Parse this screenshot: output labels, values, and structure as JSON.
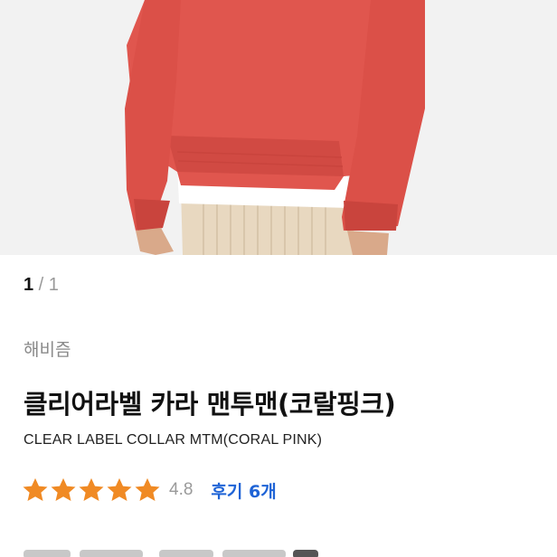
{
  "gallery": {
    "current_page": "1",
    "separator": " / ",
    "total_pages": "1"
  },
  "product": {
    "brand": "해비즘",
    "title": "클리어라벨 카라 맨투맨(코랄핑크)",
    "subtitle": "CLEAR LABEL COLLAR MTM(CORAL PINK)",
    "rating": 4.8,
    "rating_text": "4.8",
    "review_link": "후기 6개",
    "star_icon": "star-icon",
    "star_color": "#f08a24"
  },
  "colors": {
    "sweatshirt": "#e0564e",
    "shirt": "#ffffff",
    "pants": "#e8d8c0",
    "background": "#f2f2f2",
    "link": "#1e63d6"
  }
}
